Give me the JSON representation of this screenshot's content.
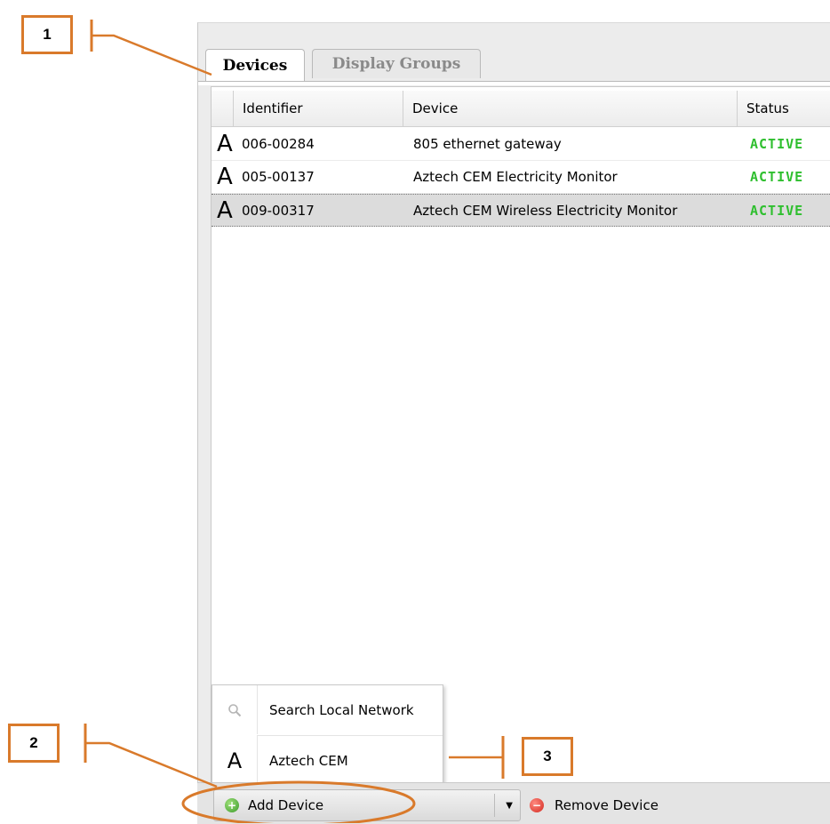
{
  "tabs": [
    {
      "label": "Devices",
      "active": true
    },
    {
      "label": "Display Groups",
      "active": false
    }
  ],
  "table": {
    "columns": [
      "Identifier",
      "Device",
      "Status"
    ],
    "rows": [
      {
        "icon": "A",
        "identifier": "006-00284",
        "device": "805 ethernet gateway",
        "status": "ACTIVE",
        "selected": false
      },
      {
        "icon": "A",
        "identifier": "005-00137",
        "device": "Aztech CEM Electricity Monitor",
        "status": "ACTIVE",
        "selected": false
      },
      {
        "icon": "A",
        "identifier": "009-00317",
        "device": "Aztech CEM Wireless Electricity Monitor",
        "status": "ACTIVE",
        "selected": true
      }
    ]
  },
  "menu": {
    "items": [
      {
        "icon": "search-icon",
        "label": "Search Local Network"
      },
      {
        "icon": "A",
        "label": "Aztech CEM"
      }
    ]
  },
  "toolbar": {
    "add_label": "Add Device",
    "remove_label": "Remove Device"
  },
  "callouts": [
    "1",
    "2",
    "3"
  ],
  "colors": {
    "accent": "#d97a2b",
    "status_active": "#2fbf2f"
  }
}
